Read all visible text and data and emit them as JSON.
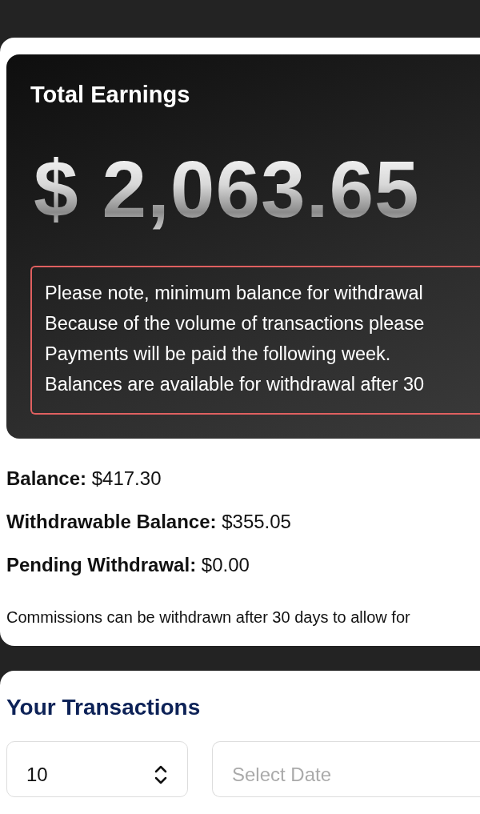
{
  "earnings_card": {
    "title": "Total Earnings",
    "amount": "$ 2,063.65",
    "notice": [
      "Please note, minimum balance for withdrawal",
      "Because of the volume of transactions please",
      "Payments will be paid the following week.",
      "Balances are available for withdrawal after 30"
    ]
  },
  "balances": [
    {
      "label": "Balance:",
      "value": "$417.30"
    },
    {
      "label": "Withdrawable Balance:",
      "value": "$355.05"
    },
    {
      "label": "Pending Withdrawal:",
      "value": "$0.00"
    }
  ],
  "commission_note": "Commissions can be withdrawn after 30 days to allow for",
  "transactions": {
    "title": "Your Transactions",
    "page_size": "10",
    "date_placeholder": "Select Date"
  }
}
